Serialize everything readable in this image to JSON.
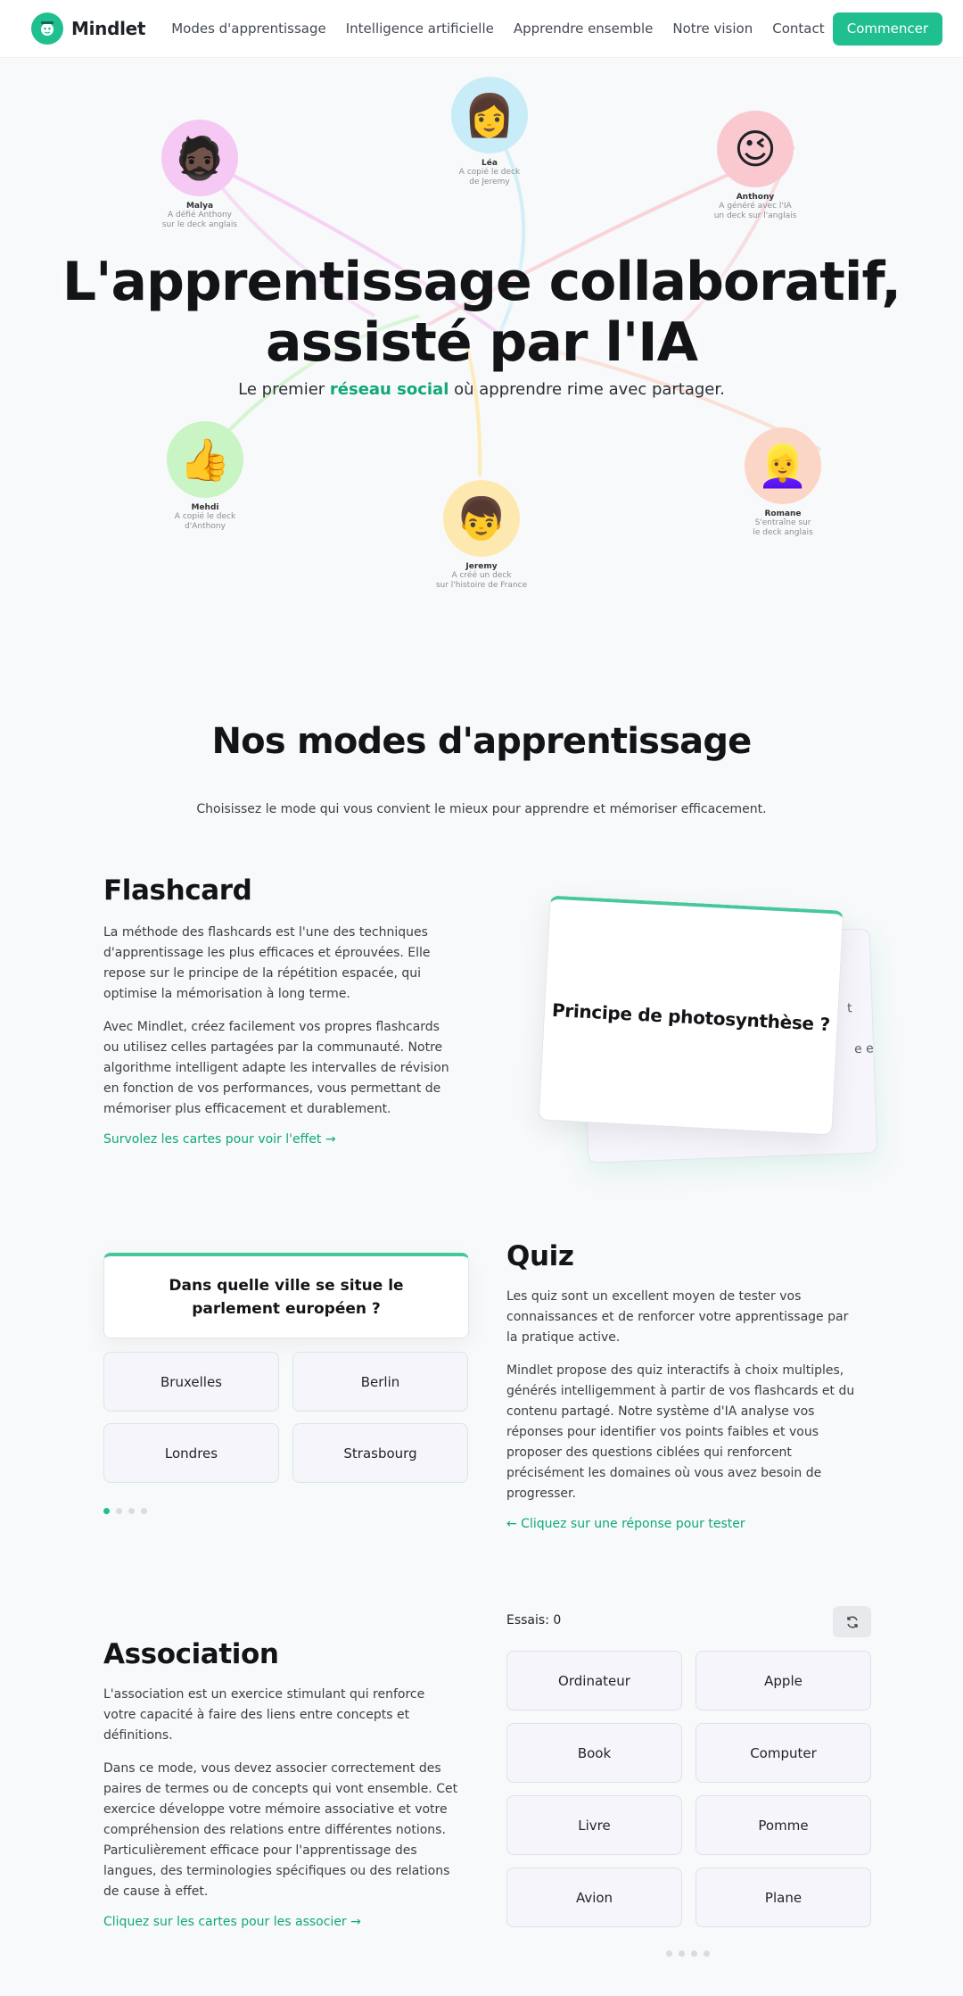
{
  "nav": {
    "brand": "Mindlet",
    "links": [
      "Modes d'apprentissage",
      "Intelligence artificielle",
      "Apprendre ensemble",
      "Notre vision",
      "Contact"
    ],
    "cta": "Commencer",
    "accent": "#1fbf8f"
  },
  "hero": {
    "title_line1": "L'apprentissage collaboratif,",
    "title_line2": "assisté par l'IA",
    "subtitle_before": "Le premier ",
    "subtitle_highlight": "réseau social",
    "subtitle_after": " où apprendre rime avec partager.",
    "people": [
      {
        "name": "Malya",
        "line1": "A défié Anthony",
        "line2": "sur le deck anglais",
        "bg": "#f6c8f4",
        "emoji": "🧔🏿"
      },
      {
        "name": "Léa",
        "line1": "A copié le deck",
        "line2": "de Jeremy",
        "bg": "#c8ecf8",
        "emoji": "👩"
      },
      {
        "name": "Anthony",
        "line1": "A généré avec l'IA",
        "line2": "un deck sur l'anglais",
        "bg": "#f9c9cf",
        "emoji": "😉"
      },
      {
        "name": "Mehdi",
        "line1": "A copié le deck",
        "line2": "d'Anthony",
        "bg": "#c9f4c4",
        "emoji": "👍"
      },
      {
        "name": "Jeremy",
        "line1": "A créé un deck",
        "line2": "sur l'histoire de France",
        "bg": "#fde9b0",
        "emoji": "👦"
      },
      {
        "name": "Romane",
        "line1": "S'entraîne sur",
        "line2": "le deck anglais",
        "bg": "#fbd6c7",
        "emoji": "👱‍♀️"
      }
    ]
  },
  "modes": {
    "title": "Nos modes d'apprentissage",
    "subtitle": "Choisissez le mode qui vous convient le mieux pour apprendre et mémoriser efficacement."
  },
  "flashcard": {
    "title": "Flashcard",
    "p1": "La méthode des flashcards est l'une des techniques d'apprentissage les plus efficaces et éprouvées. Elle repose sur le principe de la répétition espacée, qui optimise la mémorisation à long terme.",
    "p2": "Avec Mindlet, créez facilement vos propres flashcards ou utilisez celles partagées par la communauté. Notre algorithme intelligent adapte les intervalles de révision en fonction de vos performances, vous permettant de mémoriser plus efficacement et durablement.",
    "link": "Survolez les cartes pour voir l'effet →",
    "card_question": "Principe de photosynthèse ?",
    "back_peek1": "t",
    "back_peek2": "e et"
  },
  "quiz": {
    "title": "Quiz",
    "question": "Dans quelle ville se situe le parlement européen ?",
    "options": [
      "Bruxelles",
      "Berlin",
      "Londres",
      "Strasbourg"
    ],
    "p1": "Les quiz sont un excellent moyen de tester vos connaissances et de renforcer votre apprentissage par la pratique active.",
    "p2": "Mindlet propose des quiz interactifs à choix multiples, générés intelligemment à partir de vos flashcards et du contenu partagé. Notre système d'IA analyse vos réponses pour identifier vos points faibles et vous proposer des questions ciblées qui renforcent précisément les domaines où vous avez besoin de progresser.",
    "link": "← Cliquez sur une réponse pour tester"
  },
  "association": {
    "title": "Association",
    "p1": "L'association est un exercice stimulant qui renforce votre capacité à faire des liens entre concepts et définitions.",
    "p2": "Dans ce mode, vous devez associer correctement des paires de termes ou de concepts qui vont ensemble. Cet exercice développe votre mémoire associative et votre compréhension des relations entre différentes notions. Particulièrement efficace pour l'apprentissage des langues, des terminologies spécifiques ou des relations de cause à effet.",
    "link": "Cliquez sur les cartes pour les associer →",
    "tries": "Essais: 0",
    "tiles": [
      "Ordinateur",
      "Apple",
      "Book",
      "Computer",
      "Livre",
      "Pomme",
      "Avion",
      "Plane"
    ]
  }
}
